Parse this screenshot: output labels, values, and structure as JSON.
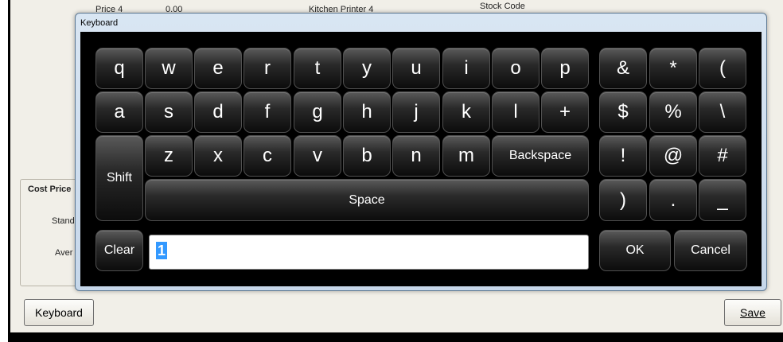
{
  "background": {
    "fields": [
      {
        "label": "Price 4",
        "value": "0.00"
      },
      {
        "label": "Kitchen Printer 4"
      },
      {
        "label": "Stock Code"
      }
    ],
    "cost_group": {
      "title": "Cost Price",
      "rows": [
        "Stand",
        "Aver"
      ]
    },
    "keyboard_button": "Keyboard",
    "save_button": "Save"
  },
  "dialog": {
    "title": "Keyboard",
    "keys": {
      "row1": [
        "q",
        "w",
        "e",
        "r",
        "t",
        "y",
        "u",
        "i",
        "o",
        "p"
      ],
      "row2": [
        "a",
        "s",
        "d",
        "f",
        "g",
        "h",
        "j",
        "k",
        "l",
        "+"
      ],
      "row3": [
        "z",
        "x",
        "c",
        "v",
        "b",
        "n",
        "m"
      ],
      "backspace": "Backspace",
      "shift": "Shift",
      "space": "Space",
      "clear": "Clear",
      "symbols": {
        "row1": [
          "&",
          "*",
          "("
        ],
        "row2": [
          "$",
          "%",
          "\\"
        ],
        "row3": [
          "!",
          "@",
          "#"
        ],
        "row4": [
          ")",
          ".",
          "_"
        ]
      },
      "ok": "OK",
      "cancel": "Cancel"
    },
    "input": {
      "value": "1"
    }
  },
  "colors": {
    "dialog_frame": "#c6d7ea",
    "keyboard_bg": "#000000",
    "key_face": "#1e1e1e",
    "selection": "#3399ff",
    "window_bg": "#f1efe8"
  }
}
